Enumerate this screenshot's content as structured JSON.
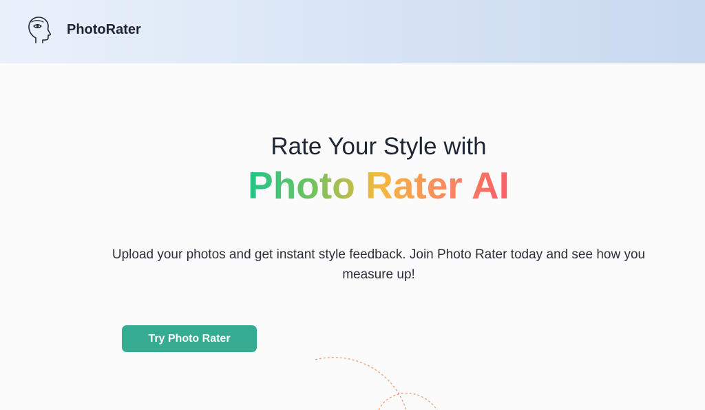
{
  "header": {
    "brand": "PhotoRater",
    "logo_icon": "head-profile-icon"
  },
  "hero": {
    "heading_line1": "Rate Your Style with",
    "heading_line2": "Photo Rater AI",
    "subtitle": "Upload your photos and get instant style feedback. Join Photo Rater today and see how you measure up!",
    "cta_label": "Try Photo Rater"
  },
  "colors": {
    "cta": "#35ab92",
    "gradient": [
      "#1ec58a",
      "#72c35f",
      "#f5b93e",
      "#fb8a5f",
      "#f85f68"
    ],
    "decoration": "#f39a72"
  }
}
